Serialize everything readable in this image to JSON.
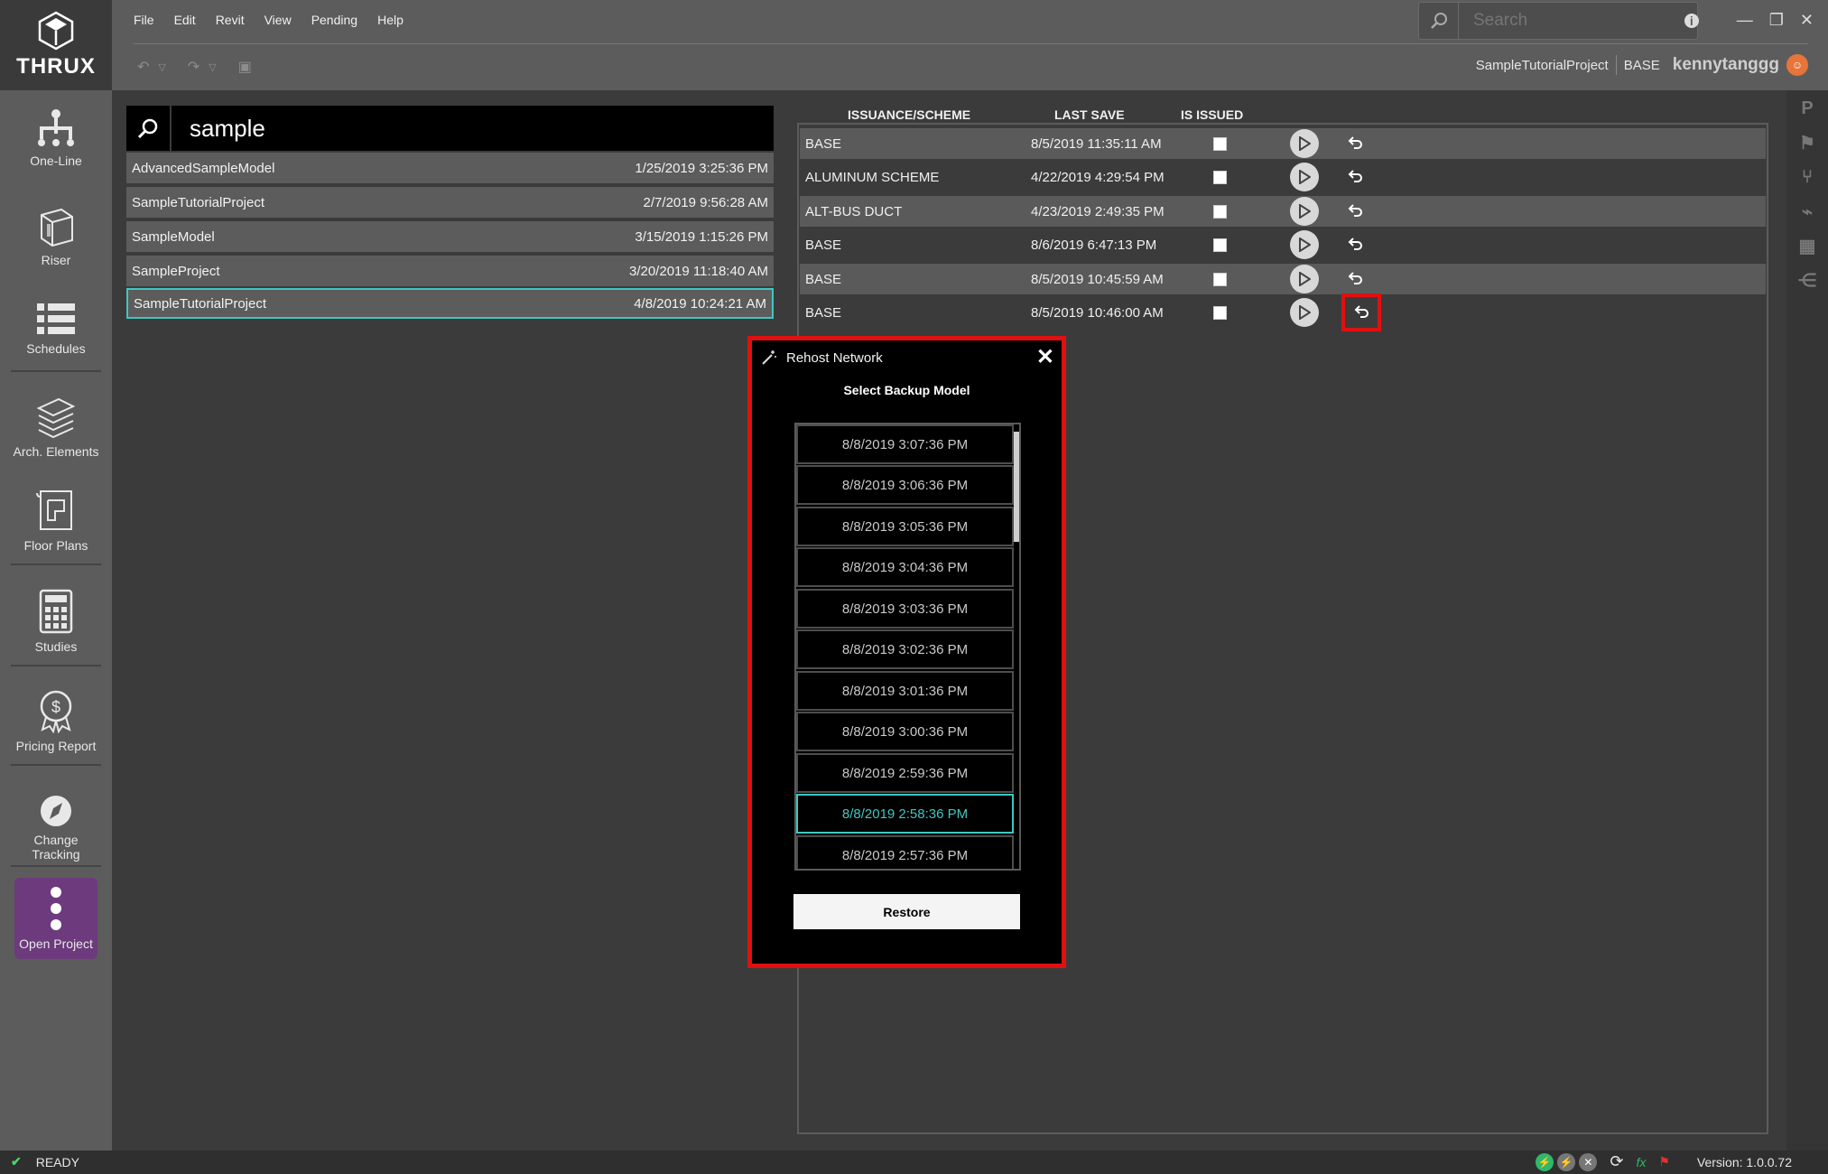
{
  "app": {
    "logo_text": "THRUX"
  },
  "menu": [
    "File",
    "Edit",
    "Revit",
    "View",
    "Pending",
    "Help"
  ],
  "search": {
    "placeholder": "Search"
  },
  "project_info": {
    "project": "SampleTutorialProject",
    "scheme": "BASE",
    "user": "kennytanggg"
  },
  "sidebar": {
    "items": [
      {
        "label": "One-Line",
        "icon": "one-line-icon"
      },
      {
        "label": "Riser",
        "icon": "riser-cube-icon"
      },
      {
        "label": "Schedules",
        "icon": "schedules-list-icon"
      },
      {
        "label": "Arch. Elements",
        "icon": "layers-icon"
      },
      {
        "label": "Floor Plans",
        "icon": "floor-plan-icon"
      },
      {
        "label": "Studies",
        "icon": "calculator-icon"
      },
      {
        "label": "Pricing Report",
        "icon": "pricing-badge-icon"
      },
      {
        "label": "Change Tracking",
        "icon": "compass-icon"
      },
      {
        "label": "Open Project",
        "icon": "more-vertical-icon"
      }
    ]
  },
  "project_search": {
    "query": "sample",
    "results": [
      {
        "name": "AdvancedSampleModel",
        "date": "1/25/2019 3:25:36 PM"
      },
      {
        "name": "SampleTutorialProject",
        "date": "2/7/2019 9:56:28 AM"
      },
      {
        "name": "SampleModel",
        "date": "3/15/2019 1:15:26 PM"
      },
      {
        "name": "SampleProject",
        "date": "3/20/2019 11:18:40 AM"
      },
      {
        "name": "SampleTutorialProject",
        "date": "4/8/2019 10:24:21 AM",
        "selected": true
      }
    ]
  },
  "issuance_table": {
    "headers": {
      "scheme": "ISSUANCE/SCHEME",
      "last_save": "LAST SAVE",
      "is_issued": "IS ISSUED"
    },
    "rows": [
      {
        "scheme": "BASE",
        "last_save": "8/5/2019 11:35:11 AM",
        "issued": false
      },
      {
        "scheme": "ALUMINUM SCHEME",
        "last_save": "4/22/2019 4:29:54 PM",
        "issued": false
      },
      {
        "scheme": "ALT-BUS DUCT",
        "last_save": "4/23/2019 2:49:35 PM",
        "issued": false
      },
      {
        "scheme": "BASE",
        "last_save": "8/6/2019 6:47:13 PM",
        "issued": false
      },
      {
        "scheme": "BASE",
        "last_save": "8/5/2019 10:45:59 AM",
        "issued": false
      },
      {
        "scheme": "BASE",
        "last_save": "8/5/2019 10:46:00 AM",
        "issued": false,
        "highlighted": true
      }
    ]
  },
  "dialog": {
    "title": "Rehost Network",
    "subtitle": "Select Backup Model",
    "backups": [
      "8/8/2019 3:07:36 PM",
      "8/8/2019 3:06:36 PM",
      "8/8/2019 3:05:36 PM",
      "8/8/2019 3:04:36 PM",
      "8/8/2019 3:03:36 PM",
      "8/8/2019 3:02:36 PM",
      "8/8/2019 3:01:36 PM",
      "8/8/2019 3:00:36 PM",
      "8/8/2019 2:59:36 PM",
      "8/8/2019 2:58:36 PM",
      "8/8/2019 2:57:36 PM"
    ],
    "selected_backup": "8/8/2019 2:58:36 PM",
    "restore_label": "Restore"
  },
  "status": {
    "text": "READY",
    "version_label": "Version:",
    "version": "1.0.0.72"
  },
  "colors": {
    "accent": "#3fc7c0",
    "highlight": "#e01010",
    "open_project": "#6d3a7d"
  }
}
